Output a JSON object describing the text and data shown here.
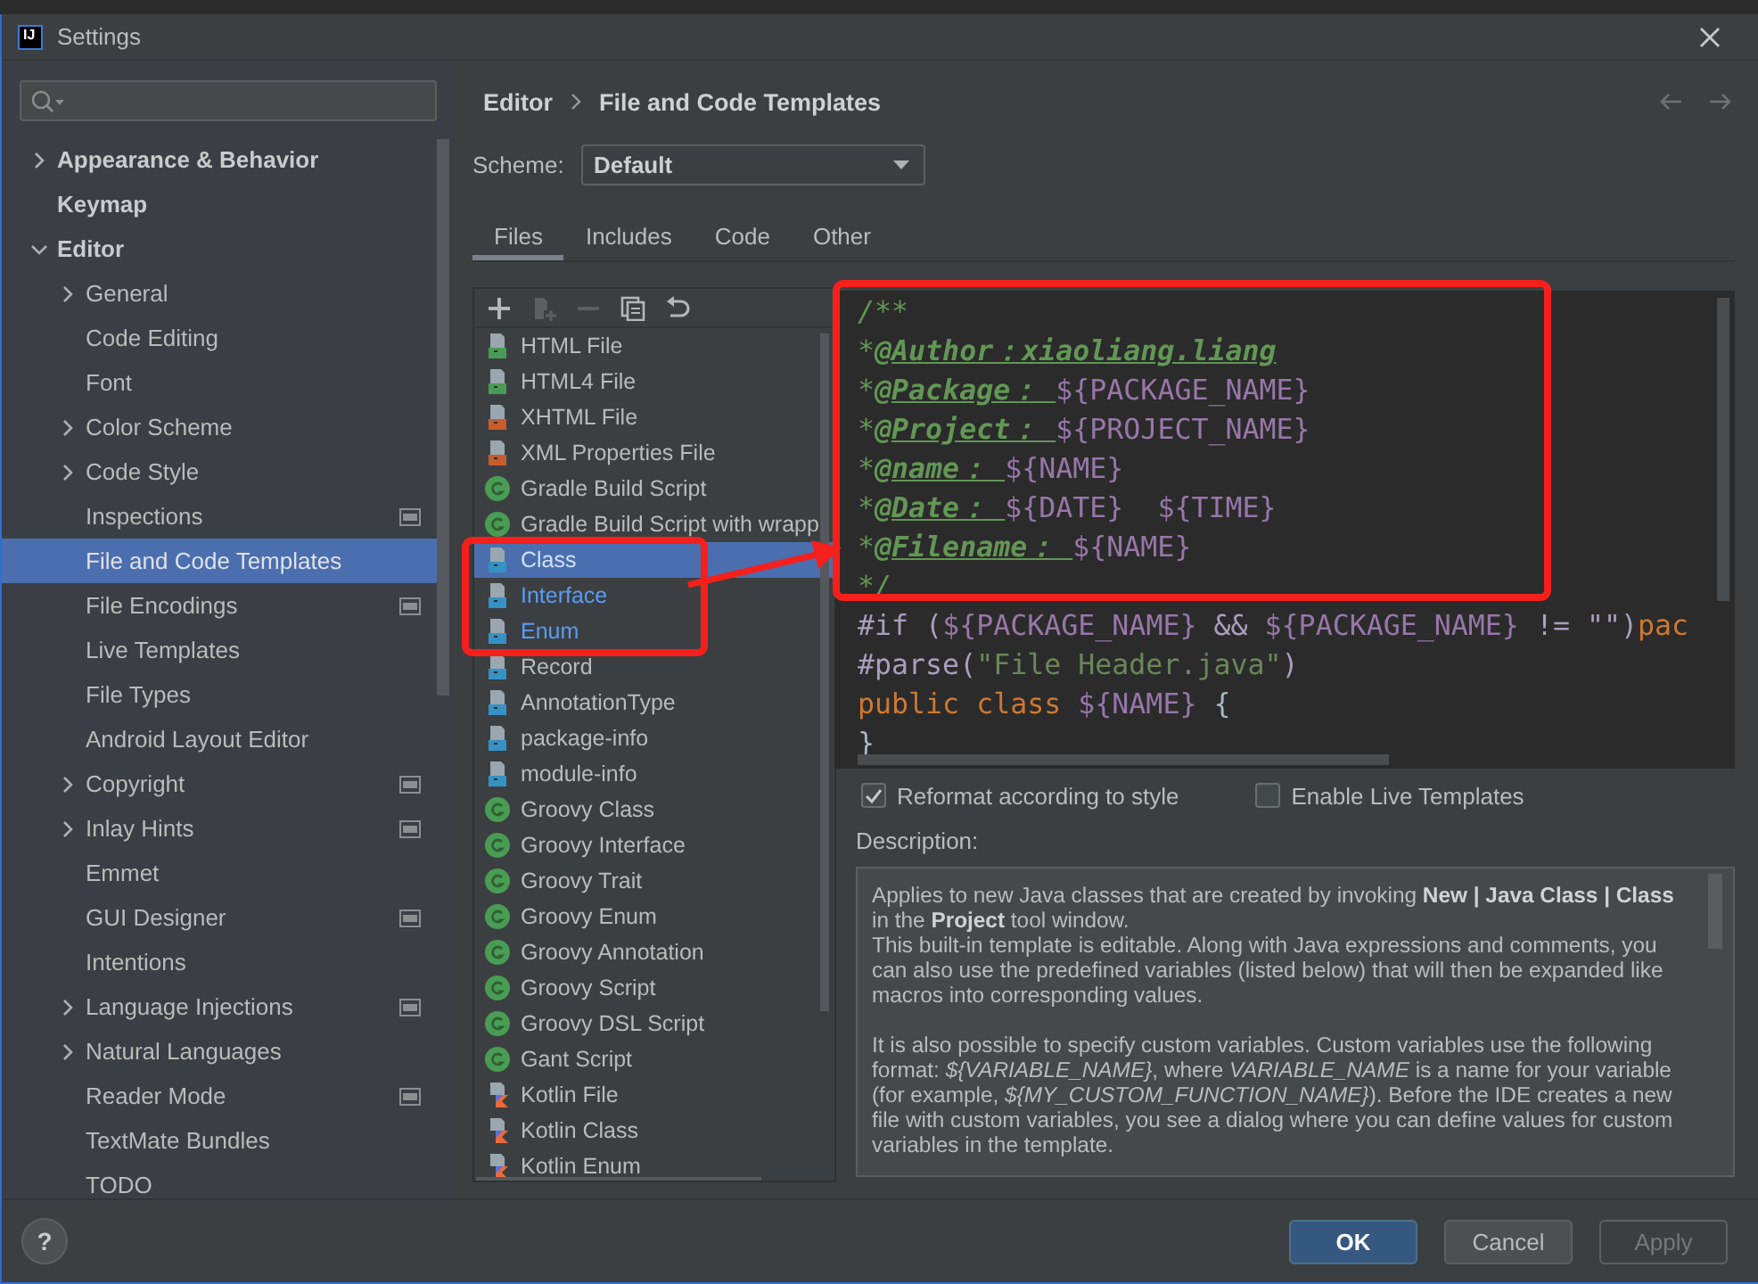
{
  "window": {
    "logo": "IJ",
    "title": "Settings"
  },
  "sidebar": {
    "items": [
      {
        "label": "Appearance & Behavior",
        "expanded": false,
        "selected": false
      },
      {
        "label": "Keymap",
        "selected": false
      },
      {
        "label": "Editor",
        "expanded": true,
        "selected": false,
        "children": [
          {
            "label": "General",
            "expanded": false,
            "selected": false
          },
          {
            "label": "Code Editing",
            "selected": false
          },
          {
            "label": "Font",
            "selected": false
          },
          {
            "label": "Color Scheme",
            "expanded": false,
            "selected": false
          },
          {
            "label": "Code Style",
            "expanded": false,
            "selected": false
          },
          {
            "label": "Inspections",
            "selected": false,
            "project_scope": true
          },
          {
            "label": "File and Code Templates",
            "selected": true
          },
          {
            "label": "File Encodings",
            "selected": false,
            "project_scope": true
          },
          {
            "label": "Live Templates",
            "selected": false
          },
          {
            "label": "File Types",
            "selected": false
          },
          {
            "label": "Android Layout Editor",
            "selected": false
          },
          {
            "label": "Copyright",
            "expanded": false,
            "selected": false,
            "project_scope": true
          },
          {
            "label": "Inlay Hints",
            "expanded": false,
            "selected": false,
            "project_scope": true
          },
          {
            "label": "Emmet",
            "selected": false
          },
          {
            "label": "GUI Designer",
            "selected": false,
            "project_scope": true
          },
          {
            "label": "Intentions",
            "selected": false
          },
          {
            "label": "Language Injections",
            "expanded": false,
            "selected": false,
            "project_scope": true
          },
          {
            "label": "Natural Languages",
            "expanded": false,
            "selected": false
          },
          {
            "label": "Reader Mode",
            "selected": false,
            "project_scope": true
          },
          {
            "label": "TextMate Bundles",
            "selected": false
          },
          {
            "label": "TODO",
            "selected": false
          }
        ]
      }
    ]
  },
  "breadcrumb": [
    "Editor",
    "File and Code Templates"
  ],
  "scheme": {
    "label": "Scheme:",
    "value": "Default"
  },
  "tabs": [
    {
      "label": "Files",
      "selected": true
    },
    {
      "label": "Includes",
      "selected": false
    },
    {
      "label": "Code",
      "selected": false
    },
    {
      "label": "Other",
      "selected": false
    }
  ],
  "toolbar": [
    {
      "kind": "add",
      "disabled": false
    },
    {
      "kind": "add_child",
      "disabled": true
    },
    {
      "kind": "remove",
      "disabled": true
    },
    {
      "kind": "copy",
      "disabled": false
    },
    {
      "kind": "reset",
      "disabled": false
    }
  ],
  "templates": [
    {
      "label": "HTML File",
      "kind": "html",
      "selected": false,
      "modified": false
    },
    {
      "label": "HTML4 File",
      "kind": "html",
      "selected": false,
      "modified": false
    },
    {
      "label": "XHTML File",
      "kind": "xhtml",
      "selected": false,
      "modified": false
    },
    {
      "label": "XML Properties File",
      "kind": "xml",
      "selected": false,
      "modified": false
    },
    {
      "label": "Gradle Build Script",
      "kind": "gradle",
      "selected": false,
      "modified": false
    },
    {
      "label": "Gradle Build Script with wrapp",
      "kind": "gradle",
      "selected": false,
      "modified": false
    },
    {
      "label": "Class",
      "kind": "java",
      "selected": true,
      "modified": true
    },
    {
      "label": "Interface",
      "kind": "java",
      "selected": false,
      "modified": true
    },
    {
      "label": "Enum",
      "kind": "java",
      "selected": false,
      "modified": true
    },
    {
      "label": "Record",
      "kind": "java",
      "selected": false,
      "modified": false
    },
    {
      "label": "AnnotationType",
      "kind": "java",
      "selected": false,
      "modified": false
    },
    {
      "label": "package-info",
      "kind": "java",
      "selected": false,
      "modified": false
    },
    {
      "label": "module-info",
      "kind": "java",
      "selected": false,
      "modified": false
    },
    {
      "label": "Groovy Class",
      "kind": "gradle",
      "selected": false,
      "modified": false
    },
    {
      "label": "Groovy Interface",
      "kind": "gradle",
      "selected": false,
      "modified": false
    },
    {
      "label": "Groovy Trait",
      "kind": "gradle",
      "selected": false,
      "modified": false
    },
    {
      "label": "Groovy Enum",
      "kind": "gradle",
      "selected": false,
      "modified": false
    },
    {
      "label": "Groovy Annotation",
      "kind": "gradle",
      "selected": false,
      "modified": false
    },
    {
      "label": "Groovy Script",
      "kind": "gradle",
      "selected": false,
      "modified": false
    },
    {
      "label": "Groovy DSL Script",
      "kind": "gradle",
      "selected": false,
      "modified": false
    },
    {
      "label": "Gant Script",
      "kind": "gradle",
      "selected": false,
      "modified": false
    },
    {
      "label": "Kotlin File",
      "kind": "kotlin",
      "selected": false,
      "modified": false
    },
    {
      "label": "Kotlin Class",
      "kind": "kotlin",
      "selected": false,
      "modified": false
    },
    {
      "label": "Kotlin Enum",
      "kind": "kotlin",
      "selected": false,
      "modified": false
    }
  ],
  "code": [
    [
      {
        "kind": "comment",
        "text": "/**"
      }
    ],
    [
      {
        "kind": "comment",
        "text": "*"
      },
      {
        "kind": "tag",
        "text": "@Author：xiaoliang.liang"
      }
    ],
    [
      {
        "kind": "comment",
        "text": "*"
      },
      {
        "kind": "tag",
        "text": "@Package： "
      },
      {
        "kind": "var",
        "text": "${PACKAGE_NAME}"
      }
    ],
    [
      {
        "kind": "comment",
        "text": "*"
      },
      {
        "kind": "tag",
        "text": "@Project： "
      },
      {
        "kind": "var",
        "text": "${PROJECT_NAME}"
      }
    ],
    [
      {
        "kind": "comment",
        "text": "*"
      },
      {
        "kind": "tag",
        "text": "@name： "
      },
      {
        "kind": "var",
        "text": "${NAME}"
      }
    ],
    [
      {
        "kind": "comment",
        "text": "*"
      },
      {
        "kind": "tag",
        "text": "@Date： "
      },
      {
        "kind": "var",
        "text": "${DATE}  ${TIME}"
      }
    ],
    [
      {
        "kind": "comment",
        "text": "*"
      },
      {
        "kind": "tag",
        "text": "@Filename： "
      },
      {
        "kind": "var",
        "text": "${NAME}"
      }
    ],
    [
      {
        "kind": "comment",
        "text": "*/"
      }
    ],
    [
      {
        "kind": "directive",
        "text": "#if ("
      },
      {
        "kind": "var",
        "text": "${PACKAGE_NAME}"
      },
      {
        "kind": "directive",
        "text": " && "
      },
      {
        "kind": "var",
        "text": "${PACKAGE_NAME}"
      },
      {
        "kind": "directive",
        "text": " != \"\")"
      },
      {
        "kind": "keyword",
        "text": "pac"
      }
    ],
    [
      {
        "kind": "directive",
        "text": "#parse("
      },
      {
        "kind": "string",
        "text": "\"File Header.java\""
      },
      {
        "kind": "directive",
        "text": ")"
      }
    ],
    [
      {
        "kind": "keyword",
        "text": "public class "
      },
      {
        "kind": "var",
        "text": "${NAME}"
      },
      {
        "kind": "plain",
        "text": " {"
      }
    ],
    [
      {
        "kind": "plain",
        "text": "}"
      }
    ]
  ],
  "options": [
    {
      "label": "Reformat according to style",
      "checked": true
    },
    {
      "label": "Enable Live Templates",
      "checked": false
    }
  ],
  "description": {
    "label": "Description:",
    "blocks": [
      [
        "Applies to new Java classes that are created by invoking **New | Java Class | Class** in the **Project** tool window.",
        "This built-in template is editable. Along with Java expressions and comments, you can also use the predefined variables (listed below) that will then be expanded like macros into corresponding values."
      ],
      [
        "It is also possible to specify custom variables. Custom variables use the following format: *${VARIABLE_NAME}*, where *VARIABLE_NAME* is a name for your variable (for example, *${MY_CUSTOM_FUNCTION_NAME}*). Before the IDE creates a new file with custom variables, you see a dialog where you can define values for custom variables in the template."
      ]
    ]
  },
  "help": "?",
  "buttons": [
    {
      "label": "OK",
      "kind": "primary"
    },
    {
      "label": "Cancel",
      "kind": "normal"
    },
    {
      "label": "Apply",
      "kind": "disabled"
    }
  ]
}
